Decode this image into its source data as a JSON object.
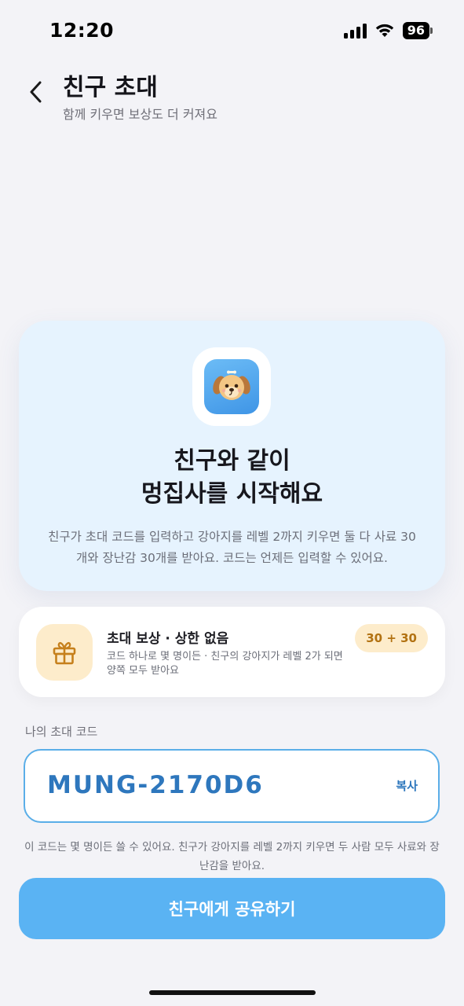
{
  "status_bar": {
    "time": "12:20",
    "battery": "96"
  },
  "header": {
    "title": "친구 초대",
    "subtitle": "함께 키우면 보상도 더 커져요"
  },
  "hero": {
    "icon": "puppy-app-icon",
    "title_line1": "친구와 같이",
    "title_line2": "멍집사를 시작해요",
    "description": "친구가 초대 코드를 입력하고 강아지를 레벨 2까지 키우면 둘 다 사료 30개와 장난감 30개를 받아요. 코드는 언제든 입력할 수 있어요."
  },
  "reward": {
    "icon": "gift-icon",
    "title": "초대 보상 · 상한 없음",
    "description": "코드 하나로 몇 명이든 · 친구의 강아지가 레벨 2가 되면 양쪽 모두 받아요",
    "badge": "30 + 30"
  },
  "invite_code": {
    "label": "나의 초대 코드",
    "value": "MUNG-2170D6",
    "copy_label": "복사",
    "note": "이 코드는 몇 명이든 쓸 수 있어요. 친구가 강아지를 레벨 2까지 키우면 두 사람 모두 사료와 장난감을 받아요."
  },
  "share_button": {
    "label": "친구에게 공유하기"
  },
  "colors": {
    "accent": "#5ab3f3",
    "code_text": "#2e77bd",
    "hero_bg": "#e6f3fe",
    "reward_badge_bg": "#fdeccb",
    "reward_badge_text": "#b27212"
  }
}
